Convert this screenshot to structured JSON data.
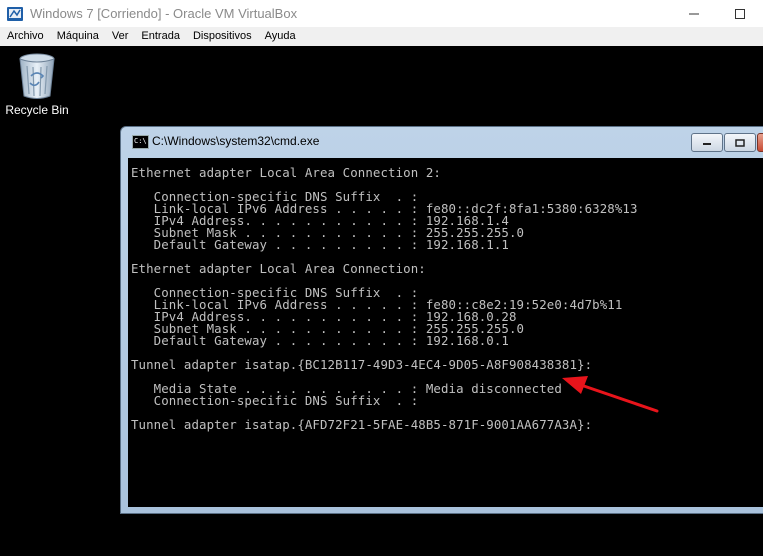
{
  "vbox": {
    "title": "Windows 7 [Corriendo] - Oracle VM VirtualBox",
    "menu": [
      "Archivo",
      "Máquina",
      "Ver",
      "Entrada",
      "Dispositivos",
      "Ayuda"
    ]
  },
  "desktop": {
    "icons": [
      {
        "label": "Recycle Bin",
        "icon": "recycle-bin-icon"
      }
    ]
  },
  "cmd": {
    "title": "C:\\Windows\\system32\\cmd.exe",
    "icon_text": "C:\\",
    "lines": [
      "Ethernet adapter Local Area Connection 2:",
      "",
      "   Connection-specific DNS Suffix  . :",
      "   Link-local IPv6 Address . . . . . : fe80::dc2f:8fa1:5380:6328%13",
      "   IPv4 Address. . . . . . . . . . . : 192.168.1.4",
      "   Subnet Mask . . . . . . . . . . . : 255.255.255.0",
      "   Default Gateway . . . . . . . . . : 192.168.1.1",
      "",
      "Ethernet adapter Local Area Connection:",
      "",
      "   Connection-specific DNS Suffix  . :",
      "   Link-local IPv6 Address . . . . . : fe80::c8e2:19:52e0:4d7b%11",
      "   IPv4 Address. . . . . . . . . . . : 192.168.0.28",
      "   Subnet Mask . . . . . . . . . . . : 255.255.255.0",
      "   Default Gateway . . . . . . . . . : 192.168.0.1",
      "",
      "Tunnel adapter isatap.{BC12B117-49D3-4EC4-9D05-A8F908438381}:",
      "",
      "   Media State . . . . . . . . . . . : Media disconnected",
      "   Connection-specific DNS Suffix  . :",
      "",
      "Tunnel adapter isatap.{AFD72F21-5FAE-48B5-871F-9001AA677A3A}:"
    ]
  },
  "colors": {
    "console_text": "#c0c0c0",
    "annotation_arrow": "#e8141b"
  }
}
